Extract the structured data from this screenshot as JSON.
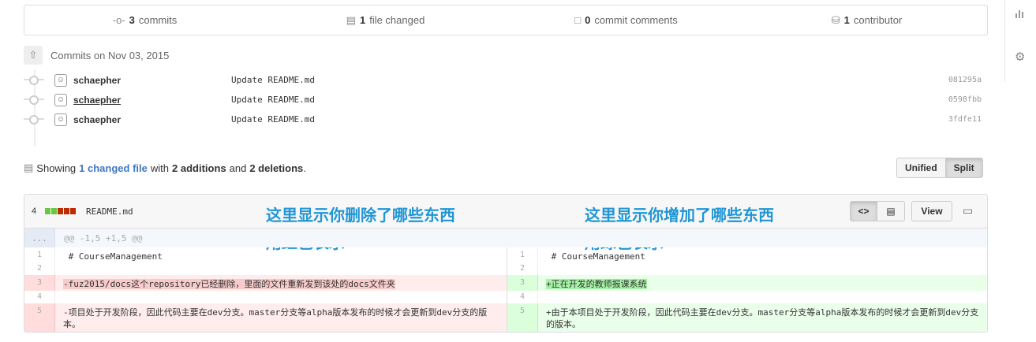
{
  "summary": {
    "commits_count": "3",
    "commits_label": "commits",
    "files_count": "1",
    "files_label": "file changed",
    "comments_count": "0",
    "comments_label": "commit comments",
    "contributors_count": "1",
    "contributors_label": "contributor"
  },
  "commits_header": "Commits on Nov 03, 2015",
  "commits": [
    {
      "author": "schaepher",
      "message": "Update README.md",
      "sha": "081295a"
    },
    {
      "author": "schaepher",
      "message": "Update README.md",
      "sha": "0598fbb"
    },
    {
      "author": "schaepher",
      "message": "Update README.md",
      "sha": "3fdfe11"
    }
  ],
  "showing": {
    "prefix": "Showing",
    "changed_link": "1 changed file",
    "with": "with",
    "additions": "2 additions",
    "and": "and",
    "deletions": "2 deletions",
    "period": "."
  },
  "view_toggle": {
    "unified": "Unified",
    "split": "Split",
    "active": "Split"
  },
  "file": {
    "change_count": "4",
    "name": "README.md",
    "view_button": "View",
    "diffstat_colors": [
      "#6cc644",
      "#6cc644",
      "#bd2c00",
      "#bd2c00",
      "#bd2c00"
    ]
  },
  "annotations": {
    "left_line1": "这里显示你删除了哪些东西",
    "left_line2": "用红色表示",
    "right_line1": "这里显示你增加了哪些东西",
    "right_line2": "用绿色表示"
  },
  "hunk": {
    "expander": "...",
    "header": "@@ -1,5 +1,5 @@"
  },
  "diff_left": [
    {
      "n": "1",
      "text": " # CourseManagement",
      "type": "ctx"
    },
    {
      "n": "2",
      "text": "",
      "type": "ctx"
    },
    {
      "n": "3",
      "text": "-fuz2015/docs这个repository已经删除，里面的文件重新发到该处的docs文件夹",
      "type": "del"
    },
    {
      "n": "4",
      "text": "",
      "type": "ctx"
    },
    {
      "n": "5",
      "text": "-项目处于开发阶段，因此代码主要在dev分支。master分支等alpha版本发布的时候才会更新到dev分支的版本。",
      "type": "del"
    }
  ],
  "diff_right": [
    {
      "n": "1",
      "text": " # CourseManagement",
      "type": "ctx"
    },
    {
      "n": "2",
      "text": "",
      "type": "ctx"
    },
    {
      "n": "3",
      "text": "+正在开发的教师报课系统",
      "type": "add"
    },
    {
      "n": "4",
      "text": "",
      "type": "ctx"
    },
    {
      "n": "5",
      "text": "+由于本项目处于开发阶段，因此代码主要在dev分支。master分支等alpha版本发布的时候才会更新到dev分支的版本。",
      "type": "add"
    }
  ]
}
